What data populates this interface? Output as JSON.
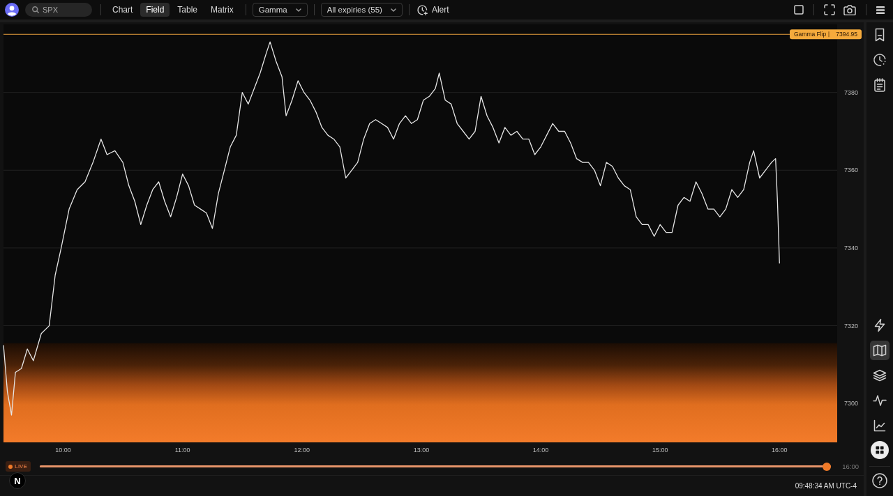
{
  "toolbar": {
    "search": {
      "value": "SPX"
    },
    "tabs": [
      {
        "label": "Chart",
        "selected": false
      },
      {
        "label": "Field",
        "selected": true
      },
      {
        "label": "Table",
        "selected": false
      },
      {
        "label": "Matrix",
        "selected": false
      }
    ],
    "mode_select": {
      "value": "Gamma"
    },
    "expiry_select": {
      "value": "All expiries (55)"
    },
    "alert_button": {
      "label": "Alert"
    }
  },
  "chart": {
    "chart_data": {
      "type": "line",
      "x": [
        9.5,
        9.533,
        9.567,
        9.6,
        9.65,
        9.7,
        9.75,
        9.817,
        9.883,
        9.933,
        9.983,
        10.05,
        10.117,
        10.183,
        10.25,
        10.317,
        10.367,
        10.433,
        10.5,
        10.55,
        10.6,
        10.65,
        10.7,
        10.75,
        10.8,
        10.85,
        10.9,
        10.95,
        11,
        11.05,
        11.1,
        11.15,
        11.2,
        11.25,
        11.3,
        11.35,
        11.4,
        11.45,
        11.5,
        11.55,
        11.6,
        11.65,
        11.7,
        11.733,
        11.783,
        11.833,
        11.867,
        11.917,
        11.967,
        12.017,
        12.067,
        12.117,
        12.167,
        12.217,
        12.267,
        12.317,
        12.367,
        12.417,
        12.467,
        12.517,
        12.567,
        12.617,
        12.667,
        12.717,
        12.767,
        12.817,
        12.867,
        12.917,
        12.967,
        13.017,
        13.067,
        13.117,
        13.15,
        13.2,
        13.25,
        13.3,
        13.35,
        13.4,
        13.45,
        13.5,
        13.55,
        13.6,
        13.65,
        13.7,
        13.75,
        13.8,
        13.85,
        13.9,
        13.95,
        14,
        14.05,
        14.1,
        14.15,
        14.2,
        14.25,
        14.3,
        14.35,
        14.4,
        14.45,
        14.5,
        14.55,
        14.6,
        14.65,
        14.7,
        14.75,
        14.8,
        14.85,
        14.9,
        14.95,
        15,
        15.05,
        15.1,
        15.15,
        15.2,
        15.25,
        15.3,
        15.35,
        15.4,
        15.45,
        15.5,
        15.55,
        15.6,
        15.65,
        15.7,
        15.75,
        15.783,
        15.833,
        15.883,
        15.933,
        15.967,
        15.983,
        16
      ],
      "series": [
        {
          "color": "#e6e6e6",
          "values": [
            7315,
            7303,
            7297,
            7308,
            7309,
            7314,
            7311,
            7318,
            7320,
            7333,
            7340,
            7350,
            7355,
            7357,
            7362,
            7368,
            7364,
            7365,
            7362,
            7356,
            7352,
            7346,
            7351,
            7355,
            7357,
            7352,
            7348,
            7353,
            7359,
            7356,
            7351,
            7350,
            7349,
            7345,
            7354,
            7360,
            7366,
            7369,
            7380,
            7377,
            7381,
            7385,
            7390,
            7393,
            7388,
            7384,
            7374,
            7378,
            7383,
            7380,
            7378,
            7375,
            7371,
            7369,
            7368,
            7366,
            7358,
            7360,
            7362,
            7368,
            7372,
            7373,
            7372,
            7371,
            7368,
            7372,
            7374,
            7372,
            7373,
            7378,
            7379,
            7381,
            7385,
            7378,
            7377,
            7372,
            7370,
            7368,
            7370,
            7379,
            7374,
            7371,
            7367,
            7371,
            7369,
            7370,
            7368,
            7368,
            7364,
            7366,
            7369,
            7372,
            7370,
            7370,
            7367,
            7363,
            7362,
            7362,
            7360,
            7356,
            7362,
            7361,
            7358,
            7356,
            7355,
            7348,
            7346,
            7346,
            7343,
            7346,
            7344,
            7344,
            7351,
            7353,
            7352,
            7357,
            7354,
            7350,
            7350,
            7348,
            7350,
            7355,
            7353,
            7355,
            7362,
            7365,
            7358,
            7360,
            7362,
            7363,
            7352,
            7336
          ]
        }
      ],
      "xlim": [
        9.5,
        16.483
      ],
      "ylim": [
        7290,
        7397.5
      ],
      "xticks": [
        {
          "value": 10,
          "label": "10:00"
        },
        {
          "value": 11,
          "label": "11:00"
        },
        {
          "value": 12,
          "label": "12:00"
        },
        {
          "value": 13,
          "label": "13:00"
        },
        {
          "value": 14,
          "label": "14:00"
        },
        {
          "value": 15,
          "label": "15:00"
        },
        {
          "value": 16,
          "label": "16:00"
        }
      ],
      "yticks": [
        7300,
        7320,
        7340,
        7360,
        7380
      ],
      "grid": true,
      "ref_lines": [
        {
          "axis": "y",
          "value": 7394.95
        }
      ]
    },
    "gamma_flip": {
      "label": "Gamma Flip",
      "value": "7394.95"
    }
  },
  "sidebar": {
    "top_tools": [
      {
        "selected": false
      },
      {
        "selected": false
      },
      {
        "selected": false
      }
    ],
    "tools": [
      {
        "selected": false
      },
      {
        "selected": true
      },
      {
        "selected": false
      },
      {
        "selected": false
      },
      {
        "selected": false
      }
    ]
  },
  "timeline": {
    "live_label": "LIVE",
    "slider": {
      "level": 1
    },
    "reading": "16:00"
  },
  "status_bar": {
    "time": "09:48:34 AM UTC-4"
  },
  "dev_badge": {
    "letter": "N"
  }
}
